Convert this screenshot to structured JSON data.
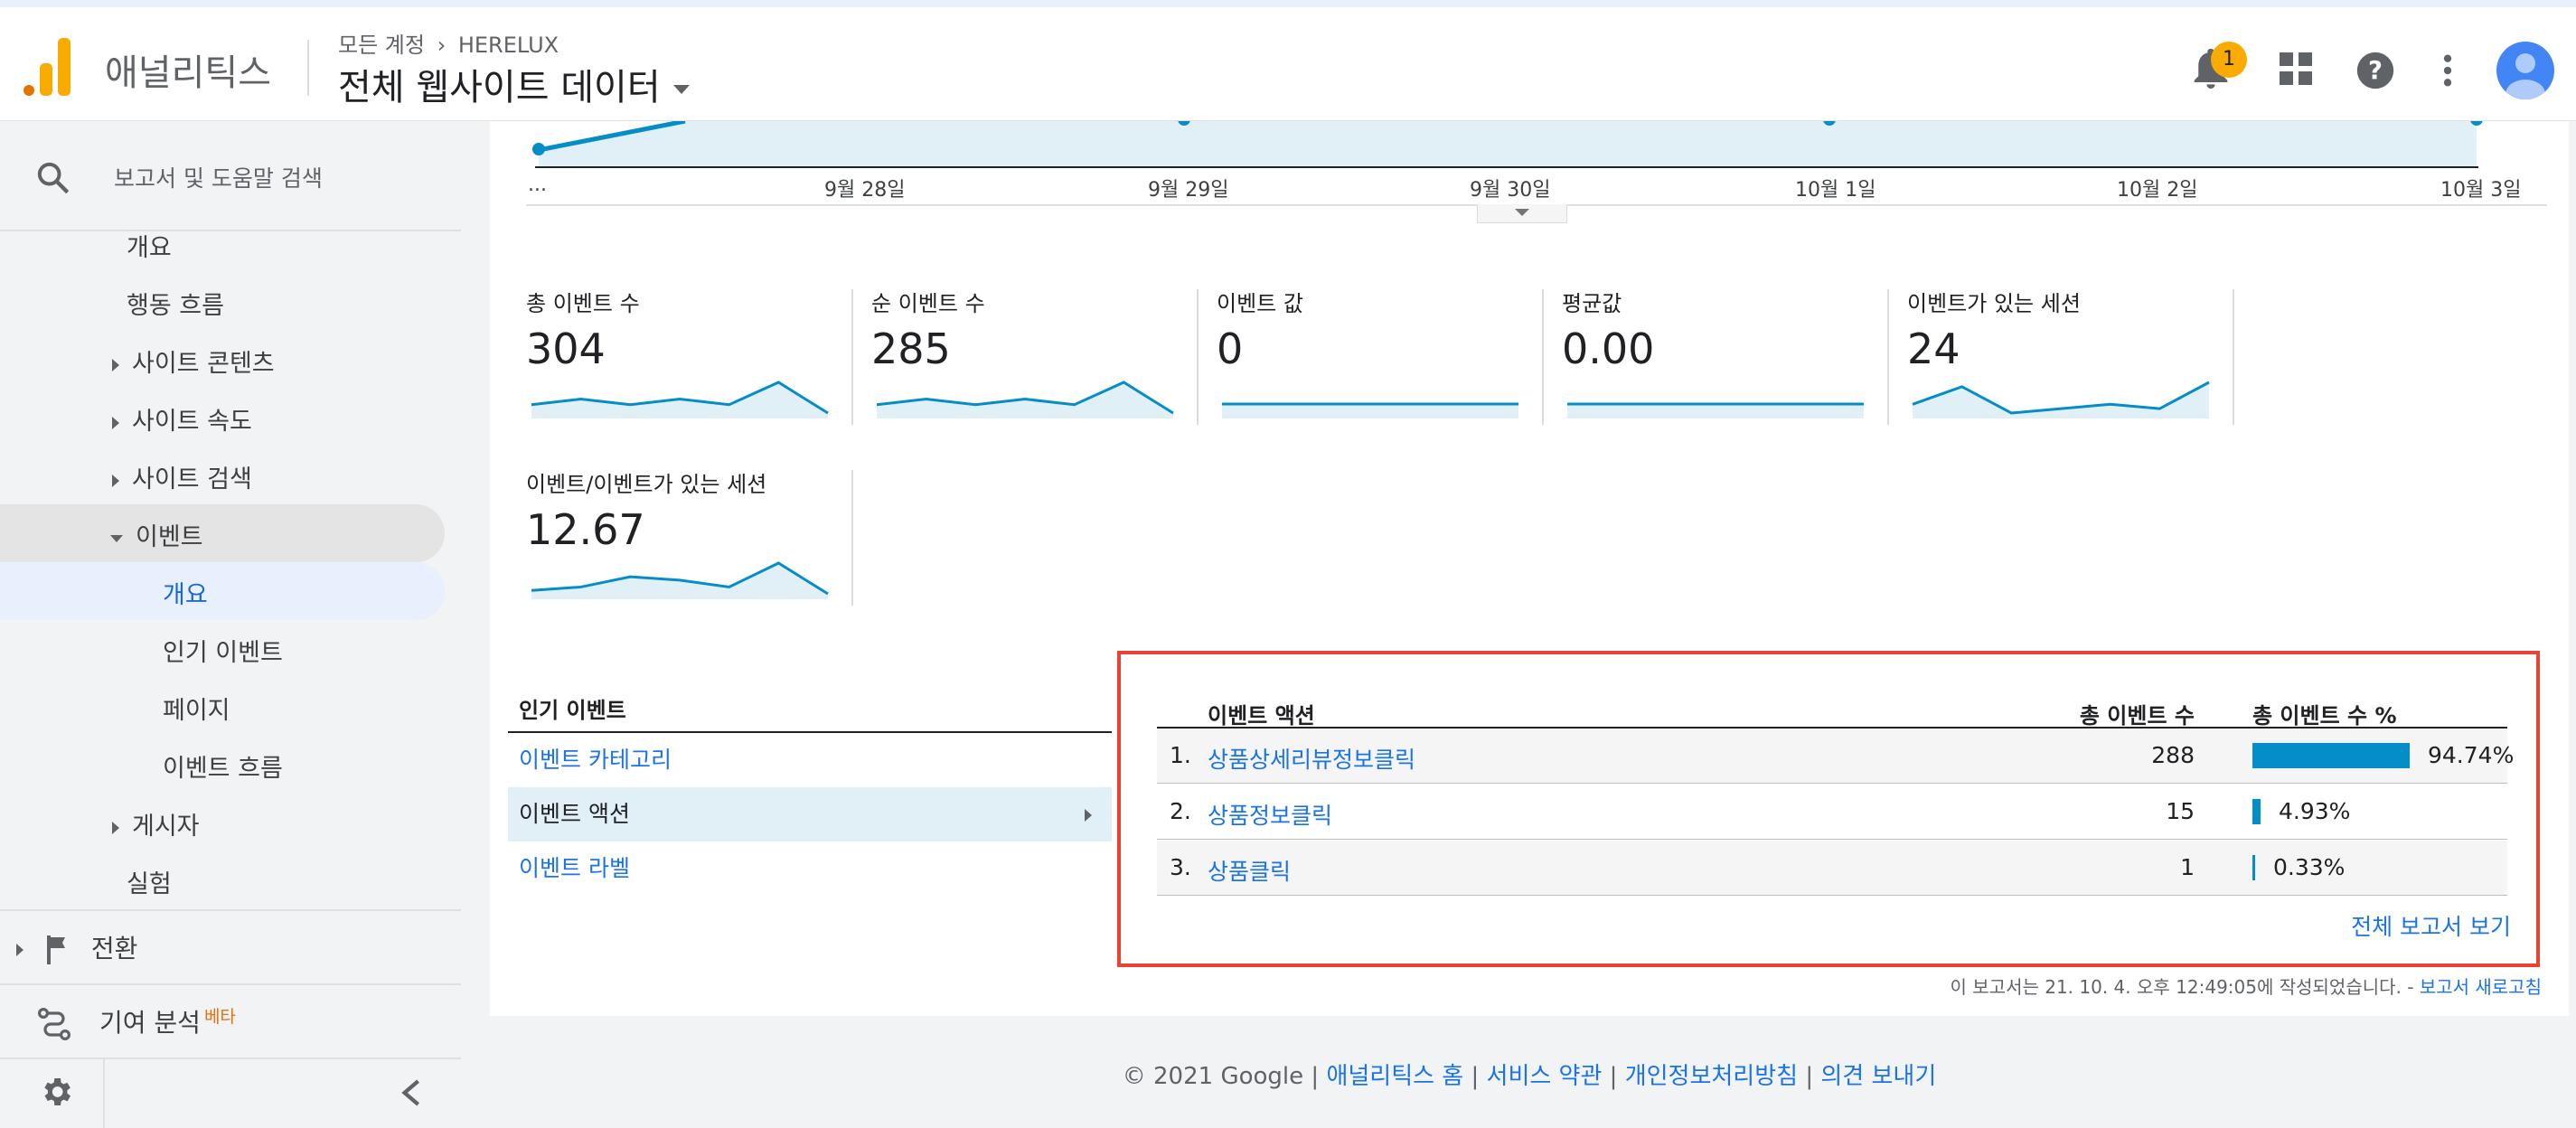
{
  "header": {
    "app_name": "애널리틱스",
    "breadcrumb_account": "모든 계정",
    "breadcrumb_property": "HERELUX",
    "view_name": "전체 웹사이트 데이터",
    "notification_count": "1"
  },
  "sidebar": {
    "search_placeholder": "보고서 및 도움말 검색",
    "items": [
      {
        "label": "개요"
      },
      {
        "label": "행동 흐름"
      },
      {
        "label": "사이트 콘텐츠"
      },
      {
        "label": "사이트 속도"
      },
      {
        "label": "사이트 검색"
      },
      {
        "label": "이벤트"
      },
      {
        "label": "개요"
      },
      {
        "label": "인기 이벤트"
      },
      {
        "label": "페이지"
      },
      {
        "label": "이벤트 흐름"
      },
      {
        "label": "게시자"
      },
      {
        "label": "실험"
      },
      {
        "label": "전환"
      },
      {
        "label": "기여 분석"
      }
    ],
    "beta_label": "베타"
  },
  "chart": {
    "x_labels": [
      "...",
      "9월 28일",
      "9월 29일",
      "9월 30일",
      "10월 1일",
      "10월 2일",
      "10월 3일"
    ],
    "line_color": "#058dc7"
  },
  "metrics": [
    {
      "name": "총 이벤트 수",
      "value": "304",
      "spark": [
        4,
        6,
        4,
        6,
        4,
        12,
        1
      ]
    },
    {
      "name": "순 이벤트 수",
      "value": "285",
      "spark": [
        4,
        6,
        4,
        6,
        4,
        12,
        1
      ]
    },
    {
      "name": "이벤트 값",
      "value": "0",
      "spark": [
        0,
        0,
        0,
        0,
        0,
        0,
        0
      ]
    },
    {
      "name": "평균값",
      "value": "0.00",
      "spark": [
        0,
        0,
        0,
        0,
        0,
        0,
        0
      ]
    },
    {
      "name": "이벤트가 있는 세션",
      "value": "24",
      "spark": [
        4,
        8,
        2,
        3,
        4,
        3,
        9
      ]
    },
    {
      "name": "이벤트/이벤트가 있는 세션",
      "value": "12.67",
      "spark": [
        2,
        3,
        6,
        5,
        3,
        10,
        1
      ]
    }
  ],
  "popular_events": {
    "title": "인기 이벤트",
    "rows": [
      "이벤트 카테고리",
      "이벤트 액션",
      "이벤트 라벨"
    ]
  },
  "event_table": {
    "col_action": "이벤트 액션",
    "col_total": "총 이벤트 수",
    "col_pct": "총 이벤트 수 %",
    "rows": [
      {
        "rank": "1.",
        "name": "상품상세리뷰정보클릭",
        "count": "288",
        "pct": "94.74%",
        "fraction": 0.9474
      },
      {
        "rank": "2.",
        "name": "상품정보클릭",
        "count": "15",
        "pct": "4.93%",
        "fraction": 0.0493
      },
      {
        "rank": "3.",
        "name": "상품클릭",
        "count": "1",
        "pct": "0.33%",
        "fraction": 0.0033
      }
    ],
    "view_full": "전체 보고서 보기"
  },
  "report_note": {
    "text": "이 보고서는 21. 10. 4. 오후 12:49:05에 작성되었습니다. -",
    "refresh": "보고서 새로고침"
  },
  "footer": {
    "copyright": "© 2021 Google",
    "links": [
      "애널리틱스 홈",
      "서비스 약관",
      "개인정보처리방침",
      "의견 보내기"
    ]
  }
}
